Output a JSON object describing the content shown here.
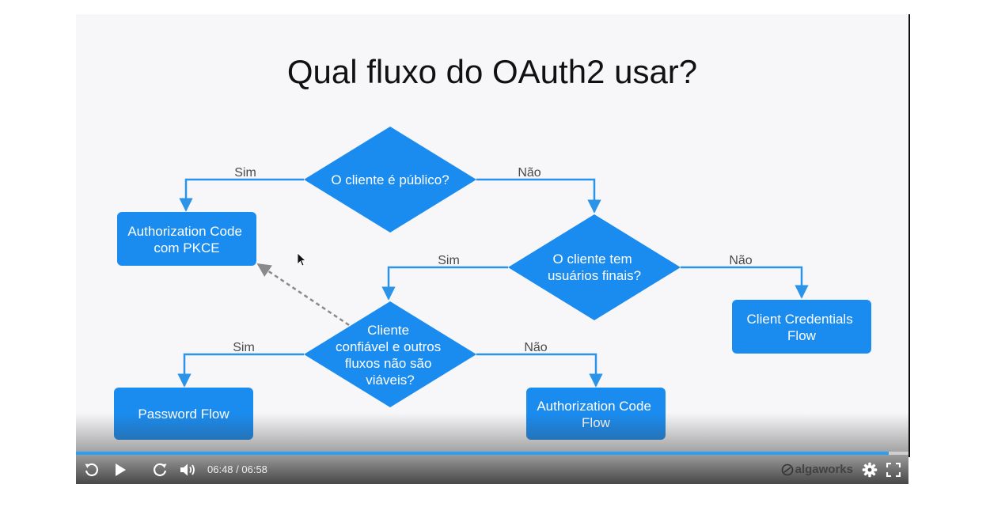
{
  "slide": {
    "title": "Qual fluxo do OAuth2 usar?",
    "nodes": {
      "q1": [
        "O cliente é público?"
      ],
      "q2": [
        "O cliente tem",
        "usuários finais?"
      ],
      "q3": [
        "Cliente",
        "confiável e outros",
        "fluxos não são",
        "viáveis?"
      ],
      "pkce": [
        "Authorization Code",
        "com PKCE"
      ],
      "client_credentials": [
        "Client Credentials",
        "Flow"
      ],
      "password": [
        "Password Flow"
      ],
      "auth_code": [
        "Authorization Code",
        "Flow"
      ]
    },
    "edge_labels": {
      "q1_yes": "Sim",
      "q1_no": "Não",
      "q2_yes": "Sim",
      "q2_no": "Não",
      "q3_yes": "Sim",
      "q3_no": "Não"
    },
    "colors": {
      "accent": "#1a8cf0",
      "arrow": "#2b93e8",
      "dashed": "#8a8a8a",
      "background": "#f7f7f9"
    }
  },
  "player": {
    "time": "06:48 / 06:58",
    "progress": 0.976,
    "brand": "algaworks",
    "icons": {
      "replay": "rewind-icon",
      "play": "play-icon",
      "forward": "forward-icon",
      "volume": "volume-icon",
      "settings": "gear-icon",
      "fullscreen": "fullscreen-icon",
      "brand_logo": "algaworks-logo-icon"
    }
  }
}
